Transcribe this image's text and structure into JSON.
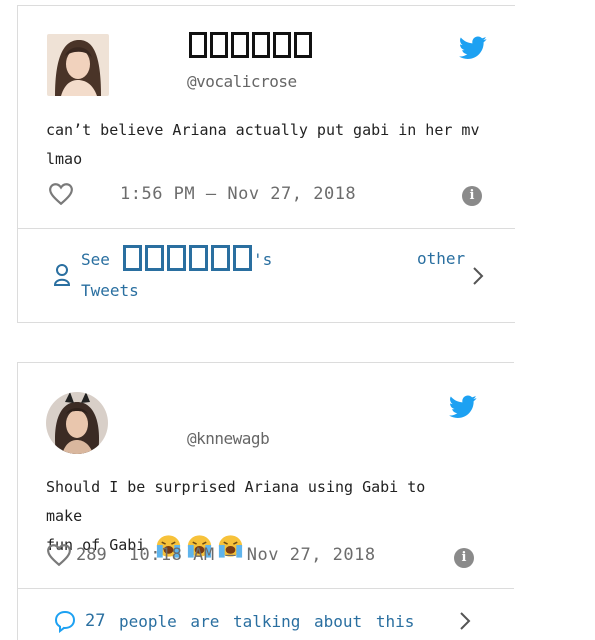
{
  "tweet1": {
    "display_name_glyphs": 6,
    "handle": "@vocalicrose",
    "text_line1": "can’t believe Ariana actually put gabi in her mv",
    "text_line2": "lmao",
    "timestamp": "1:56 PM — Nov 27, 2018",
    "see_label": "See",
    "possessive": "'s",
    "other_label": "other",
    "tweets_label": "Tweets"
  },
  "tweet2": {
    "handle": "@knnewagb",
    "text_line1": "Should I be surprised Ariana using Gabi to make",
    "text_line2": "fun of Gabi",
    "emoji": [
      "loudly-crying-face",
      "loudly-crying-face",
      "loudly-crying-face"
    ],
    "like_count": "289",
    "timestamp": "10:18 AM — Nov 27, 2018",
    "talk_count": "27",
    "talk_label": "people are talking about this"
  },
  "colors": {
    "twitter_blue": "#1da1f2",
    "link_blue": "#2a6fa0",
    "muted_gray": "#6c6c6c",
    "border": "#dcdcdc"
  },
  "icons": [
    "twitter-bird-icon",
    "heart-icon",
    "info-icon",
    "person-icon",
    "chevron-right-icon",
    "comment-bubble-icon"
  ]
}
